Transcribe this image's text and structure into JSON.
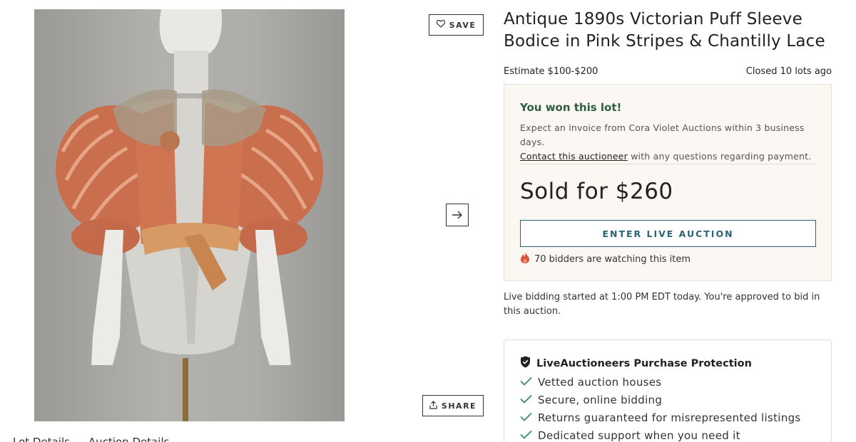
{
  "listing": {
    "title": "Antique 1890s Victorian Puff Sleeve Bodice in Pink Stripes & Chantilly Lace",
    "estimate": "Estimate $100-$200",
    "closed_status": "Closed 10 lots ago"
  },
  "actions": {
    "save_label": "SAVE",
    "share_label": "SHARE"
  },
  "won_panel": {
    "title": "You won this lot!",
    "message": "Expect an invoice from Cora Violet Auctions within 3 business days.",
    "contact_link": "Contact this auctioneer",
    "contact_suffix": "with any questions regarding payment.",
    "sold_text": "Sold for $260",
    "enter_live_label": "ENTER LIVE AUCTION",
    "watching_text": "70 bidders are watching this item"
  },
  "live_info": "Live bidding started at 1:00 PM EDT today. You're approved to bid in this auction.",
  "protection": {
    "title": "LiveAuctioneers Purchase Protection",
    "items": [
      "Vetted auction houses",
      "Secure, online bidding",
      "Returns guaranteed for misrepresented listings",
      "Dedicated support when you need it"
    ]
  },
  "tabs": [
    "Lot Details",
    "Auction Details"
  ],
  "colors": {
    "accent_green": "#2f5d44",
    "accent_teal": "#2a6374",
    "panel_bg": "#fbf7f2",
    "flame": "#d9533e"
  },
  "icons": {
    "save": "heart-icon",
    "share": "share-upload-icon",
    "next": "arrow-right-icon",
    "watching": "flame-icon",
    "protection": "shield-check-icon",
    "bullet": "checkmark-icon"
  }
}
